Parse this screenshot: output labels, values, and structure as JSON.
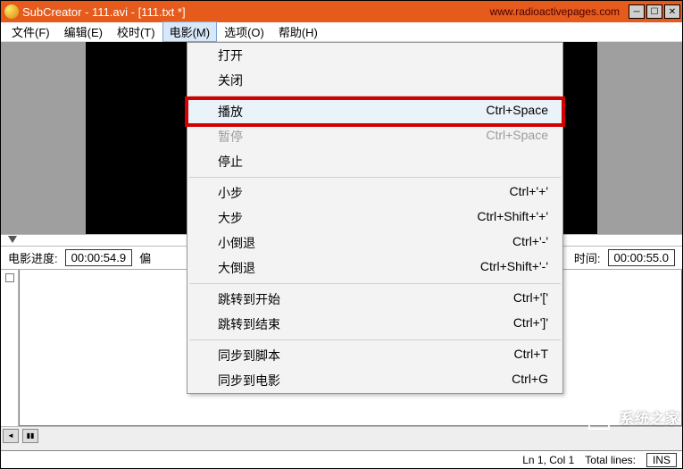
{
  "titlebar": {
    "title": "SubCreator - 111.avi - [111.txt *]",
    "url": "www.radioactivepages.com"
  },
  "menubar": {
    "file": "文件(F)",
    "edit": "编辑(E)",
    "timing": "校时(T)",
    "movie": "电影(M)",
    "options": "选项(O)",
    "help": "帮助(H)"
  },
  "dropdown": {
    "open": "打开",
    "close": "关闭",
    "play": {
      "label": "播放",
      "shortcut": "Ctrl+Space"
    },
    "pause": {
      "label": "暂停",
      "shortcut": "Ctrl+Space"
    },
    "stop": "停止",
    "smallstep": {
      "label": "小步",
      "shortcut": "Ctrl+'+'"
    },
    "bigstep": {
      "label": "大步",
      "shortcut": "Ctrl+Shift+'+'"
    },
    "smallback": {
      "label": "小倒退",
      "shortcut": "Ctrl+'-'"
    },
    "bigback": {
      "label": "大倒退",
      "shortcut": "Ctrl+Shift+'-'"
    },
    "jumpstart": {
      "label": "跳转到开始",
      "shortcut": "Ctrl+'['"
    },
    "jumpend": {
      "label": "跳转到结束",
      "shortcut": "Ctrl+']'"
    },
    "syncscript": {
      "label": "同步到脚本",
      "shortcut": "Ctrl+T"
    },
    "syncmovie": {
      "label": "同步到电影",
      "shortcut": "Ctrl+G"
    }
  },
  "progress": {
    "label": "电影进度:",
    "value": "00:00:54.9",
    "offset_label_left": "偏",
    "time_label_right": "时间:",
    "time_value": "00:00:55.0"
  },
  "status": {
    "pos": "Ln 1, Col 1",
    "total": "Total lines:",
    "mode": "INS"
  },
  "watermark": "系统之家"
}
